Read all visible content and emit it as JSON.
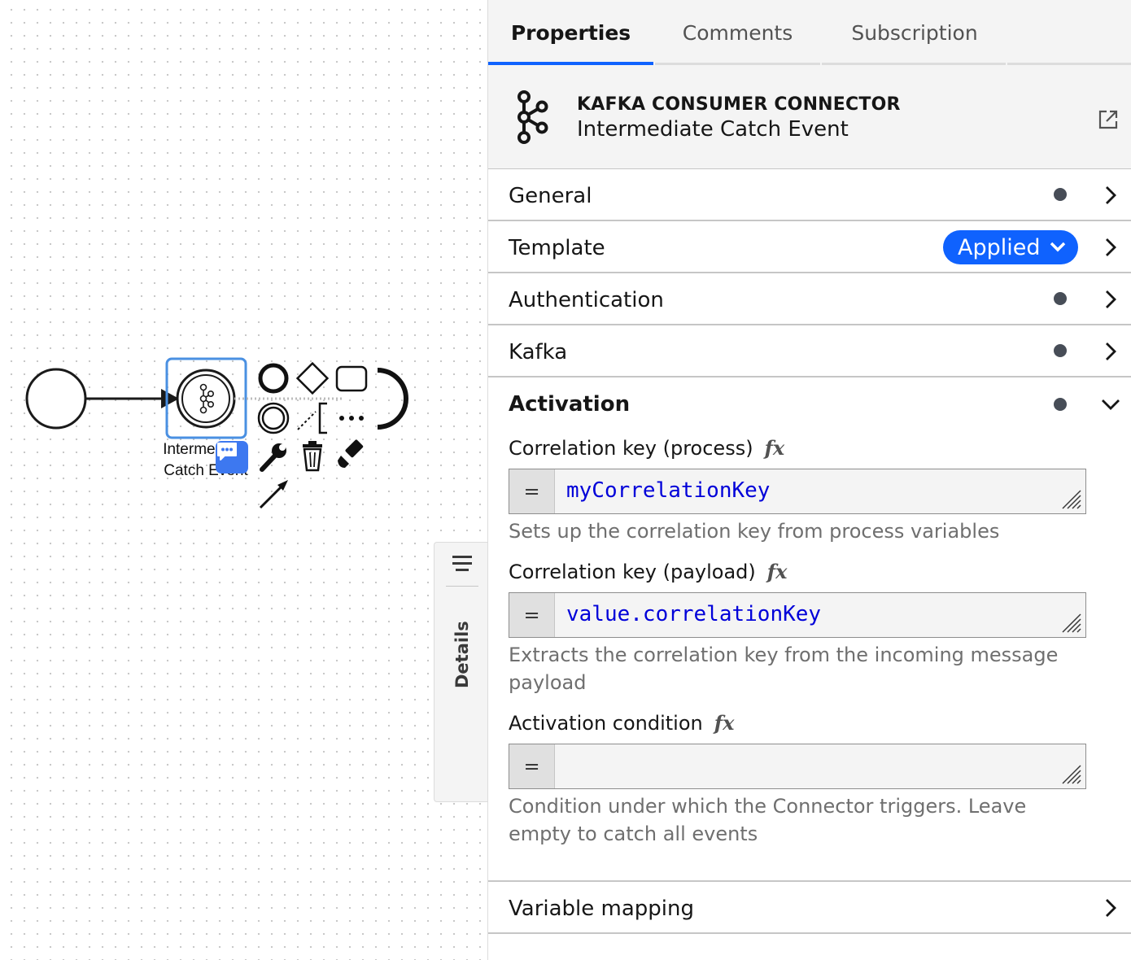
{
  "canvas": {
    "element_label_line1": "Intermediate",
    "element_label_line2": "Catch Event"
  },
  "details_tab": {
    "label": "Details"
  },
  "tabs": [
    {
      "label": "Properties",
      "active": true
    },
    {
      "label": "Comments",
      "active": false
    },
    {
      "label": "Subscription",
      "active": false
    }
  ],
  "element": {
    "type": "KAFKA CONSUMER CONNECTOR",
    "name": "Intermediate Catch Event",
    "icon": "kafka-icon"
  },
  "groups": {
    "general": "General",
    "template": "Template",
    "template_badge": "Applied",
    "authentication": "Authentication",
    "kafka": "Kafka",
    "activation": "Activation",
    "variable_mapping": "Variable mapping"
  },
  "activation": {
    "corr_process_label": "Correlation key (process)",
    "corr_process_value": "myCorrelationKey",
    "corr_process_desc": "Sets up the correlation key from process variables",
    "corr_payload_label": "Correlation key (payload)",
    "corr_payload_value": "value.correlationKey",
    "corr_payload_desc": "Extracts the correlation key from the incoming message payload",
    "condition_label": "Activation condition",
    "condition_value": "",
    "condition_desc": "Condition under which the Connector triggers. Leave empty to catch all events",
    "fx": "fx",
    "eq": "="
  },
  "colors": {
    "accent": "#0f62fe",
    "selection": "#4a90e2",
    "comment": "#3d78f0"
  }
}
